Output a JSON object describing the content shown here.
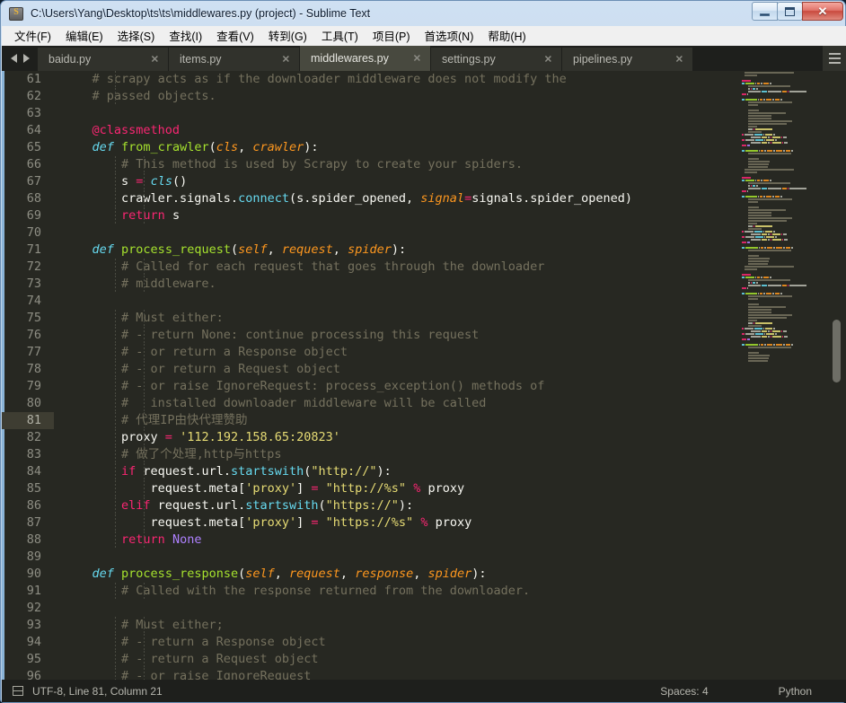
{
  "window": {
    "title": "C:\\Users\\Yang\\Desktop\\ts\\ts\\middlewares.py (project) - Sublime Text",
    "app_icon": "sublime-text-icon",
    "minimize_label": "–",
    "maximize_label": "□",
    "close_label": "✕"
  },
  "menubar": {
    "items": [
      {
        "label": "文件(F)"
      },
      {
        "label": "编辑(E)"
      },
      {
        "label": "选择(S)"
      },
      {
        "label": "查找(I)"
      },
      {
        "label": "查看(V)"
      },
      {
        "label": "转到(G)"
      },
      {
        "label": "工具(T)"
      },
      {
        "label": "项目(P)"
      },
      {
        "label": "首选项(N)"
      },
      {
        "label": "帮助(H)"
      }
    ]
  },
  "tabbar": {
    "close_glyph": "✕",
    "tabs": [
      {
        "label": "baidu.py",
        "active": false
      },
      {
        "label": "items.py",
        "active": false
      },
      {
        "label": "middlewares.py",
        "active": true
      },
      {
        "label": "settings.py",
        "active": false
      },
      {
        "label": "pipelines.py",
        "active": false
      }
    ]
  },
  "editor": {
    "first_line": 61,
    "current_line": 81,
    "lines": [
      {
        "n": 61,
        "guides": [
          1
        ],
        "tokens": [
          {
            "t": "    # scrapy acts as if the downloader middleware does not modify the",
            "c": "c-comment"
          }
        ]
      },
      {
        "n": 62,
        "guides": [
          1
        ],
        "tokens": [
          {
            "t": "    # passed objects.",
            "c": "c-comment"
          }
        ]
      },
      {
        "n": 63,
        "guides": [],
        "tokens": []
      },
      {
        "n": 64,
        "guides": [],
        "tokens": [
          {
            "t": "    ",
            "c": "c-plain"
          },
          {
            "t": "@classmethod",
            "c": "c-deco"
          }
        ]
      },
      {
        "n": 65,
        "guides": [],
        "tokens": [
          {
            "t": "    ",
            "c": "c-plain"
          },
          {
            "t": "def",
            "c": "c-def"
          },
          {
            "t": " ",
            "c": "c-plain"
          },
          {
            "t": "from_crawler",
            "c": "c-func"
          },
          {
            "t": "(",
            "c": "c-plain"
          },
          {
            "t": "cls",
            "c": "c-param"
          },
          {
            "t": ", ",
            "c": "c-plain"
          },
          {
            "t": "crawler",
            "c": "c-param"
          },
          {
            "t": "):",
            "c": "c-plain"
          }
        ]
      },
      {
        "n": 66,
        "guides": [
          1,
          2
        ],
        "tokens": [
          {
            "t": "        # This method is used by Scrapy to create your spiders.",
            "c": "c-comment"
          }
        ]
      },
      {
        "n": 67,
        "guides": [
          1,
          2
        ],
        "tokens": [
          {
            "t": "        s ",
            "c": "c-plain"
          },
          {
            "t": "=",
            "c": "c-keyword"
          },
          {
            "t": " ",
            "c": "c-plain"
          },
          {
            "t": "cls",
            "c": "c-cls"
          },
          {
            "t": "()",
            "c": "c-plain"
          }
        ]
      },
      {
        "n": 68,
        "guides": [
          1,
          2
        ],
        "tokens": [
          {
            "t": "        crawler.signals.",
            "c": "c-plain"
          },
          {
            "t": "connect",
            "c": "c-method"
          },
          {
            "t": "(s.spider_opened, ",
            "c": "c-plain"
          },
          {
            "t": "signal",
            "c": "c-italic"
          },
          {
            "t": "=",
            "c": "c-keyword"
          },
          {
            "t": "signals.spider_opened)",
            "c": "c-plain"
          }
        ]
      },
      {
        "n": 69,
        "guides": [
          1,
          2
        ],
        "tokens": [
          {
            "t": "        ",
            "c": "c-plain"
          },
          {
            "t": "return",
            "c": "c-keyword"
          },
          {
            "t": " s",
            "c": "c-plain"
          }
        ]
      },
      {
        "n": 70,
        "guides": [],
        "tokens": []
      },
      {
        "n": 71,
        "guides": [],
        "tokens": [
          {
            "t": "    ",
            "c": "c-plain"
          },
          {
            "t": "def",
            "c": "c-def"
          },
          {
            "t": " ",
            "c": "c-plain"
          },
          {
            "t": "process_request",
            "c": "c-func"
          },
          {
            "t": "(",
            "c": "c-plain"
          },
          {
            "t": "self",
            "c": "c-param"
          },
          {
            "t": ", ",
            "c": "c-plain"
          },
          {
            "t": "request",
            "c": "c-param"
          },
          {
            "t": ", ",
            "c": "c-plain"
          },
          {
            "t": "spider",
            "c": "c-param"
          },
          {
            "t": "):",
            "c": "c-plain"
          }
        ]
      },
      {
        "n": 72,
        "guides": [
          1,
          2
        ],
        "tokens": [
          {
            "t": "        # Called for each request that goes through the downloader",
            "c": "c-comment"
          }
        ]
      },
      {
        "n": 73,
        "guides": [
          1,
          2
        ],
        "tokens": [
          {
            "t": "        # middleware.",
            "c": "c-comment"
          }
        ]
      },
      {
        "n": 74,
        "guides": [],
        "tokens": []
      },
      {
        "n": 75,
        "guides": [
          1,
          2
        ],
        "tokens": [
          {
            "t": "        # Must either:",
            "c": "c-comment"
          }
        ]
      },
      {
        "n": 76,
        "guides": [
          1,
          2
        ],
        "tokens": [
          {
            "t": "        # - return None: continue processing this request",
            "c": "c-comment"
          }
        ]
      },
      {
        "n": 77,
        "guides": [
          1,
          2
        ],
        "tokens": [
          {
            "t": "        # - or return a Response object",
            "c": "c-comment"
          }
        ]
      },
      {
        "n": 78,
        "guides": [
          1,
          2
        ],
        "tokens": [
          {
            "t": "        # - or return a Request object",
            "c": "c-comment"
          }
        ]
      },
      {
        "n": 79,
        "guides": [
          1,
          2
        ],
        "tokens": [
          {
            "t": "        # - or raise IgnoreRequest: process_exception() methods of",
            "c": "c-comment"
          }
        ]
      },
      {
        "n": 80,
        "guides": [
          1,
          2
        ],
        "tokens": [
          {
            "t": "        #   installed downloader middleware will be called",
            "c": "c-comment"
          }
        ]
      },
      {
        "n": 81,
        "guides": [
          1,
          2
        ],
        "tokens": [
          {
            "t": "        # 代理IP由快代理赞助",
            "c": "c-comment"
          }
        ]
      },
      {
        "n": 82,
        "guides": [
          1,
          2
        ],
        "tokens": [
          {
            "t": "        proxy ",
            "c": "c-plain"
          },
          {
            "t": "=",
            "c": "c-keyword"
          },
          {
            "t": " ",
            "c": "c-plain"
          },
          {
            "t": "'112.192.158.65:20823'",
            "c": "c-string"
          }
        ]
      },
      {
        "n": 83,
        "guides": [
          1,
          2
        ],
        "tokens": [
          {
            "t": "        # 做了个处理,http与https",
            "c": "c-comment"
          }
        ]
      },
      {
        "n": 84,
        "guides": [
          1,
          2
        ],
        "tokens": [
          {
            "t": "        ",
            "c": "c-plain"
          },
          {
            "t": "if",
            "c": "c-keyword"
          },
          {
            "t": " request.url.",
            "c": "c-plain"
          },
          {
            "t": "startswith",
            "c": "c-method"
          },
          {
            "t": "(",
            "c": "c-plain"
          },
          {
            "t": "\"http://\"",
            "c": "c-string"
          },
          {
            "t": "):",
            "c": "c-plain"
          }
        ]
      },
      {
        "n": 85,
        "guides": [
          1,
          2
        ],
        "tokens": [
          {
            "t": "            request.meta[",
            "c": "c-plain"
          },
          {
            "t": "'proxy'",
            "c": "c-string"
          },
          {
            "t": "] ",
            "c": "c-plain"
          },
          {
            "t": "=",
            "c": "c-keyword"
          },
          {
            "t": " ",
            "c": "c-plain"
          },
          {
            "t": "\"http://%s\"",
            "c": "c-string"
          },
          {
            "t": " ",
            "c": "c-plain"
          },
          {
            "t": "%",
            "c": "c-keyword"
          },
          {
            "t": " proxy",
            "c": "c-plain"
          }
        ]
      },
      {
        "n": 86,
        "guides": [
          1,
          2
        ],
        "tokens": [
          {
            "t": "        ",
            "c": "c-plain"
          },
          {
            "t": "elif",
            "c": "c-keyword"
          },
          {
            "t": " request.url.",
            "c": "c-plain"
          },
          {
            "t": "startswith",
            "c": "c-method"
          },
          {
            "t": "(",
            "c": "c-plain"
          },
          {
            "t": "\"https://\"",
            "c": "c-string"
          },
          {
            "t": "):",
            "c": "c-plain"
          }
        ]
      },
      {
        "n": 87,
        "guides": [
          1,
          2
        ],
        "tokens": [
          {
            "t": "            request.meta[",
            "c": "c-plain"
          },
          {
            "t": "'proxy'",
            "c": "c-string"
          },
          {
            "t": "] ",
            "c": "c-plain"
          },
          {
            "t": "=",
            "c": "c-keyword"
          },
          {
            "t": " ",
            "c": "c-plain"
          },
          {
            "t": "\"https://%s\"",
            "c": "c-string"
          },
          {
            "t": " ",
            "c": "c-plain"
          },
          {
            "t": "%",
            "c": "c-keyword"
          },
          {
            "t": " proxy",
            "c": "c-plain"
          }
        ]
      },
      {
        "n": 88,
        "guides": [
          1,
          2
        ],
        "tokens": [
          {
            "t": "        ",
            "c": "c-plain"
          },
          {
            "t": "return",
            "c": "c-keyword"
          },
          {
            "t": " ",
            "c": "c-plain"
          },
          {
            "t": "None",
            "c": "c-const"
          }
        ]
      },
      {
        "n": 89,
        "guides": [],
        "tokens": []
      },
      {
        "n": 90,
        "guides": [],
        "tokens": [
          {
            "t": "    ",
            "c": "c-plain"
          },
          {
            "t": "def",
            "c": "c-def"
          },
          {
            "t": " ",
            "c": "c-plain"
          },
          {
            "t": "process_response",
            "c": "c-func"
          },
          {
            "t": "(",
            "c": "c-plain"
          },
          {
            "t": "self",
            "c": "c-param"
          },
          {
            "t": ", ",
            "c": "c-plain"
          },
          {
            "t": "request",
            "c": "c-param"
          },
          {
            "t": ", ",
            "c": "c-plain"
          },
          {
            "t": "response",
            "c": "c-param"
          },
          {
            "t": ", ",
            "c": "c-plain"
          },
          {
            "t": "spider",
            "c": "c-param"
          },
          {
            "t": "):",
            "c": "c-plain"
          }
        ]
      },
      {
        "n": 91,
        "guides": [
          1,
          2
        ],
        "tokens": [
          {
            "t": "        # Called with the response returned from the downloader.",
            "c": "c-comment"
          }
        ]
      },
      {
        "n": 92,
        "guides": [],
        "tokens": []
      },
      {
        "n": 93,
        "guides": [
          1,
          2
        ],
        "tokens": [
          {
            "t": "        # Must either;",
            "c": "c-comment"
          }
        ]
      },
      {
        "n": 94,
        "guides": [
          1,
          2
        ],
        "tokens": [
          {
            "t": "        # - return a Response object",
            "c": "c-comment"
          }
        ]
      },
      {
        "n": 95,
        "guides": [
          1,
          2
        ],
        "tokens": [
          {
            "t": "        # - return a Request object",
            "c": "c-comment"
          }
        ]
      },
      {
        "n": 96,
        "guides": [
          1,
          2
        ],
        "tokens": [
          {
            "t": "        # - or raise IgnoreRequest",
            "c": "c-comment"
          }
        ]
      }
    ]
  },
  "statusbar": {
    "encoding_icon": "document-icon",
    "left_text": "UTF-8, Line 81, Column 21",
    "indent": "Spaces: 4",
    "syntax": "Python"
  },
  "colors": {
    "editor_bg": "#272822",
    "chrome_bg": "#1e1f1c",
    "tab_inactive": "#31322c",
    "tab_active": "#48493f",
    "comment": "#75715e",
    "keyword": "#f92672",
    "function": "#a6e22e",
    "string": "#e6db74",
    "constant": "#ae81ff",
    "type": "#66d9ef",
    "param": "#fd971f",
    "accent": "#8ab4d8"
  }
}
